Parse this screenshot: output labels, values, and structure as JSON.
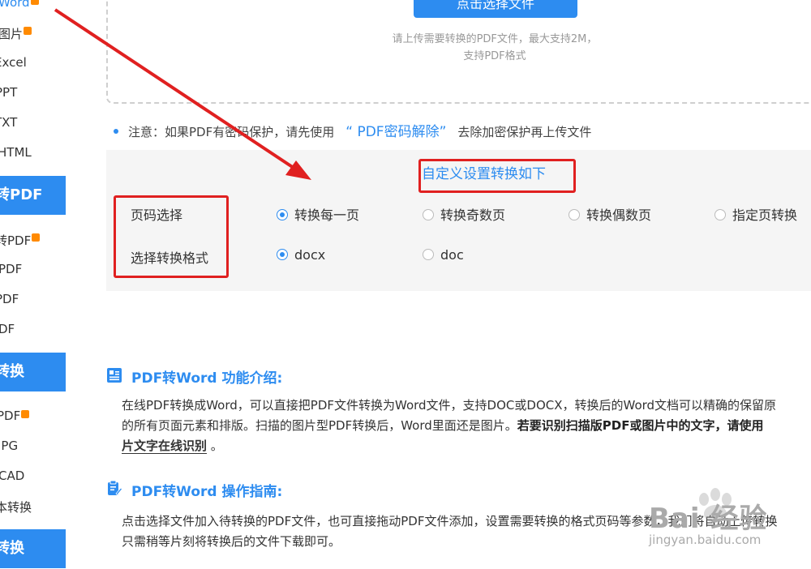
{
  "sidebar": {
    "items_top": [
      "Word",
      "图片",
      "Excel",
      "PPT",
      "TXT",
      "HTML"
    ],
    "head1": "转PDF",
    "items_mid": [
      "转PDF",
      "PDF",
      "PDF",
      "DF"
    ],
    "head2": "转换",
    "items_bot": [
      "PDF",
      "JPG",
      "CAD",
      "本转换"
    ],
    "head3": "转换"
  },
  "upload": {
    "button_label": "点击选择文件",
    "hint_line1": "请上传需要转换的PDF文件，最大支持2M，",
    "hint_line2": "支持PDF格式"
  },
  "notice": {
    "prefix": "注意：如果PDF有密码保护，请先使用",
    "link": "“ PDF密码解除”",
    "suffix": "去除加密保护再上传文件"
  },
  "settings": {
    "title": "自定义设置转换如下",
    "page_label": "页码选择",
    "page_options": [
      "转换每一页",
      "转换奇数页",
      "转换偶数页",
      "指定页转换"
    ],
    "page_selected": 0,
    "format_label": "选择转换格式",
    "format_options": [
      "docx",
      "doc"
    ],
    "format_selected": 0
  },
  "intro": {
    "title": "PDF转Word 功能介绍:",
    "line1": "在线PDF转换成Word，可以直接把PDF文件转换为Word文件，支持DOC或DOCX，转换后的Word文档可以精确的保留原",
    "line2_plain": "的所有页面元素和排版。扫描的图片型PDF转换后，Word里面还是图片。",
    "line2_bold": "若要识别扫描版PDF或图片中的文字，请使用",
    "line3_link": "片文字在线识别",
    "line3_end": "。"
  },
  "guide": {
    "title": "PDF转Word 操作指南:",
    "line1": "点击选择文件加入待转换的PDF文件，也可直接拖动PDF文件添加，设置需要转换的格式页码等参数，我们将自动上传转换",
    "line2": "只需稍等片刻将转换后的文件下载即可。"
  },
  "watermark": {
    "text": "Bai 经验",
    "url": "jingyan.baidu.com"
  },
  "colors": {
    "accent": "#2d8cf0",
    "annotation": "#e02020"
  }
}
